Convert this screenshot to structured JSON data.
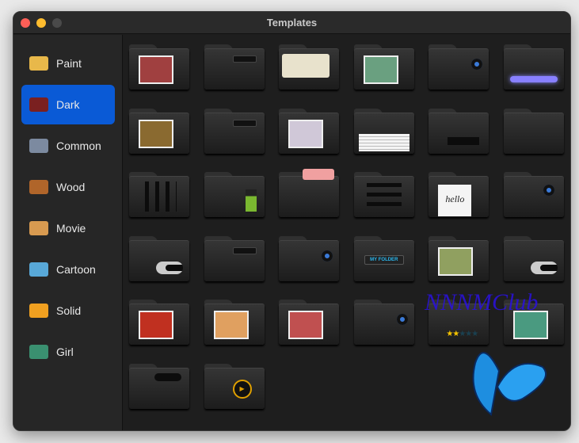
{
  "window": {
    "title": "Templates"
  },
  "sidebar": {
    "items": [
      {
        "label": "Paint",
        "color": "#e8b84a"
      },
      {
        "label": "Dark",
        "color": "#7a2020",
        "selected": true
      },
      {
        "label": "Common",
        "color": "#7c8aa0"
      },
      {
        "label": "Wood",
        "color": "#b0652a"
      },
      {
        "label": "Movie",
        "color": "#d89a50"
      },
      {
        "label": "Cartoon",
        "color": "#58a8d8"
      },
      {
        "label": "Solid",
        "color": "#f0a020"
      },
      {
        "label": "Girl",
        "color": "#3a9070"
      }
    ]
  },
  "templates": [
    {
      "decor": "photo",
      "color": "#a04040"
    },
    {
      "decor": "switch"
    },
    {
      "decor": "cassette"
    },
    {
      "decor": "photo",
      "color": "#6aa080"
    },
    {
      "decor": "button"
    },
    {
      "decor": "glowbar"
    },
    {
      "decor": "photo",
      "color": "#8a6a30"
    },
    {
      "decor": "switch"
    },
    {
      "decor": "photo",
      "color": "#d0c8d8"
    },
    {
      "decor": "papers"
    },
    {
      "decor": "slot"
    },
    {
      "decor": "plain"
    },
    {
      "decor": "bars"
    },
    {
      "decor": "battery"
    },
    {
      "decor": "tag"
    },
    {
      "decor": "sliders"
    },
    {
      "decor": "note",
      "text": "hello"
    },
    {
      "decor": "heart"
    },
    {
      "decor": "toggle"
    },
    {
      "decor": "switch"
    },
    {
      "decor": "button"
    },
    {
      "decor": "label",
      "text": "MY FOLDER"
    },
    {
      "decor": "photo",
      "color": "#90a060"
    },
    {
      "decor": "toggle"
    },
    {
      "decor": "photo",
      "color": "#c03020"
    },
    {
      "decor": "photo",
      "color": "#e0a060"
    },
    {
      "decor": "photo",
      "color": "#c05050"
    },
    {
      "decor": "button"
    },
    {
      "decor": "stars",
      "rating": 2,
      "max": 5
    },
    {
      "decor": "photo",
      "color": "#4a9a80"
    },
    {
      "decor": "dots"
    },
    {
      "decor": "play"
    }
  ],
  "watermark": "NNNMClub",
  "colors": {
    "accent": "#0a5ad6"
  }
}
